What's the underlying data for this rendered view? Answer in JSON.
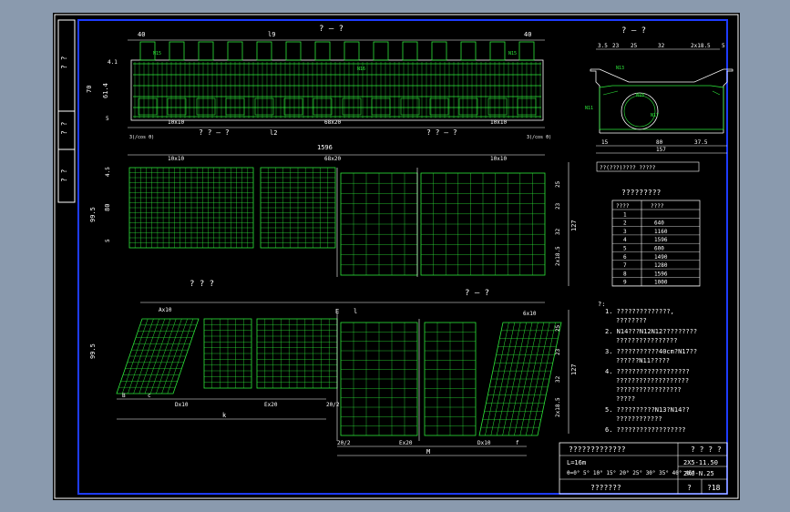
{
  "colors": {
    "background": "#8a9aae",
    "sheet": "#000000",
    "line": "#ffffff",
    "rebar": "#2de83a",
    "frame": "#1e3cff"
  },
  "side_tab": [
    "? ?",
    "? ?",
    "? ?"
  ],
  "sections": {
    "top_title": "? — ?",
    "right_title": "? — ?",
    "plan_left_title": "? ?  ?",
    "plan_right_title": "? — ?",
    "mid_left_label": "? ? — ?",
    "mid_right_label": "? ? — ?"
  },
  "dims": {
    "d40": "40",
    "d40b": "40",
    "l9": "l9",
    "l2": "l2",
    "d1596": "1596",
    "left_spacing": "10x10",
    "mid_spacing": "68x20",
    "right_spacing": "10x10",
    "cos1": "3(/cos θ)",
    "cos2": "3(/cos θ)",
    "h70": "70",
    "h61": "61.4",
    "h4": "4.1",
    "h5": "5",
    "v45": "4.5",
    "v80": "80",
    "v995": "99.5",
    "v5": "5",
    "r25": "25",
    "r23": "23",
    "r32": "32",
    "r2x185": "2x18.5",
    "r5": "5",
    "r127": "127",
    "ax10": "Ax10",
    "dx10": "Dx10",
    "ex20": "Ex20",
    "k": "k",
    "b": "B",
    "c": "c",
    "ex20b": "Ex20",
    "dx10b": "Dx10",
    "f": "f",
    "e": "E",
    "m": "M",
    "l1": "l",
    "six10": "6x10",
    "twenty2": "20/2",
    "twenty2b": "20/2",
    "sec_dims": [
      "3.5",
      "23",
      "25",
      "32",
      "2x18.5",
      "5",
      "80",
      "157",
      "37.5",
      "15"
    ]
  },
  "rebar_tags": [
    "N15",
    "N3",
    "N15",
    "N16",
    "N4",
    "N6",
    "N10",
    "N12",
    "N11",
    "N18",
    "N13",
    "N17",
    "N14",
    "N1",
    "N2",
    "N5",
    "N7",
    "N8",
    "N9"
  ],
  "schedule": {
    "title": "?????????",
    "headers": [
      "????",
      "????"
    ],
    "rows": [
      [
        "1",
        ""
      ],
      [
        "2",
        "640"
      ],
      [
        "3",
        "1160"
      ],
      [
        "4",
        "1596"
      ],
      [
        "5",
        "600"
      ],
      [
        "6",
        "1490"
      ],
      [
        "7",
        "1280"
      ],
      [
        "8",
        "1596"
      ],
      [
        "9",
        "1000"
      ]
    ]
  },
  "section_note": "??(???)???? ?????",
  "notes": {
    "head": "?:",
    "items": [
      "1. ??????????????,  ????????",
      "2. N14???N12N12?????????  ????????????????",
      "3. ???????????40cm?N17??  ??????N11?????",
      "4. ???????????????????  ???????????????????  ?????????????????  ?????",
      "5. ??????????N13?N14??  ????????????",
      "6. ??????????????????"
    ]
  },
  "title_block": {
    "name": "?????????????",
    "span": "L=16m",
    "angles": "θ=0° 5° 10° 15° 20° 25° 30° 35° 40° 45°",
    "r1": "? ? ? ?",
    "r2": "2X5-11.50",
    "r3": "2X0-N.25",
    "designer": "???????",
    "page_label": "?",
    "page_no": "?18"
  }
}
